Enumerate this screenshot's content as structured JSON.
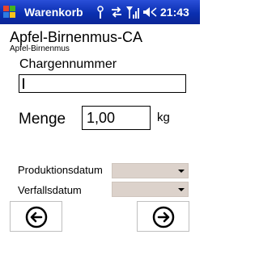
{
  "titlebar": {
    "app_title": "Warenkorb",
    "time": "21:43",
    "icons": [
      "windows-start-icon",
      "connectivity-icon",
      "sync-icon",
      "signal-icon",
      "volume-icon"
    ]
  },
  "product": {
    "title": "Apfel-Birnenmus-CA",
    "subtitle": "Apfel-Birnenmus"
  },
  "form": {
    "charge_label": "Chargennummer",
    "charge_value": "",
    "menge_label": "Menge",
    "menge_value": "1,00",
    "unit": "kg",
    "produktionsdatum_label": "Produktionsdatum",
    "produktionsdatum_value": "",
    "verfallsdatum_label": "Verfallsdatum",
    "verfallsdatum_value": ""
  },
  "navigation": {
    "back_icon": "arrow-left-circle-icon",
    "forward_icon": "arrow-right-circle-icon"
  },
  "colors": {
    "titlebar": "#0a2fb0",
    "dropdown_bg": "#dcd2cb"
  }
}
